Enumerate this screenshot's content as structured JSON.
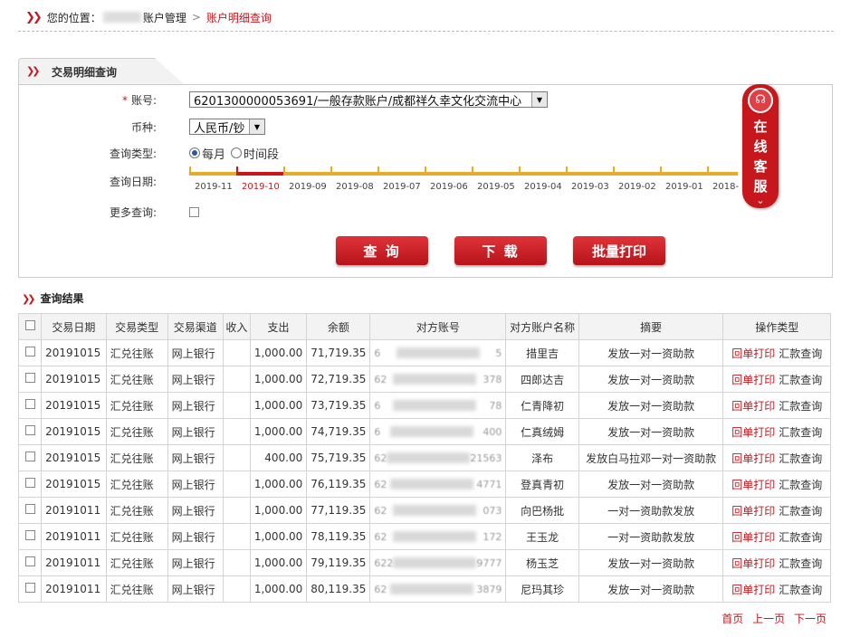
{
  "breadcrumb": {
    "prefix": "您的位置：",
    "mid": "账户管理",
    "sep": ">",
    "current": "账户明细查询"
  },
  "tab": {
    "title": "交易明细查询"
  },
  "form": {
    "account_label": "账号:",
    "account_value": "6201300000053691/一般存款账户/成都祥久幸文化交流中心",
    "currency_label": "币种:",
    "currency_value": "人民币/钞",
    "query_type_label": "查询类型:",
    "query_type_options": [
      "每月",
      "时间段"
    ],
    "query_date_label": "查询日期:",
    "months": [
      "2019-11",
      "2019-10",
      "2019-09",
      "2019-08",
      "2019-07",
      "2019-06",
      "2019-05",
      "2019-04",
      "2019-03",
      "2019-02",
      "2019-01",
      "2018-"
    ],
    "selected_month": "2019-10",
    "more_query_label": "更多查询:"
  },
  "buttons": {
    "query": "查 询",
    "download": "下 载",
    "batch_print": "批量打印"
  },
  "customer_service": {
    "text": "在线客服"
  },
  "results": {
    "title": "查询结果",
    "columns": [
      "交易日期",
      "交易类型",
      "交易渠道",
      "收入",
      "支出",
      "余额",
      "对方账号",
      "对方账户名称",
      "摘要",
      "操作类型"
    ],
    "rows": [
      {
        "date": "20191015",
        "type": "汇兑往账",
        "channel": "网上银行",
        "income": "",
        "expense": "1,000.00",
        "balance": "71,719.35",
        "acct_prefix": "6",
        "acct_suffix": "5",
        "name": "措里吉",
        "memo": "发放一对一资助款"
      },
      {
        "date": "20191015",
        "type": "汇兑往账",
        "channel": "网上银行",
        "income": "",
        "expense": "1,000.00",
        "balance": "72,719.35",
        "acct_prefix": "62",
        "acct_suffix": "378",
        "name": "四郎达吉",
        "memo": "发放一对一资助款"
      },
      {
        "date": "20191015",
        "type": "汇兑往账",
        "channel": "网上银行",
        "income": "",
        "expense": "1,000.00",
        "balance": "73,719.35",
        "acct_prefix": "6",
        "acct_suffix": "78",
        "name": "仁青降初",
        "memo": "发放一对一资助款"
      },
      {
        "date": "20191015",
        "type": "汇兑往账",
        "channel": "网上银行",
        "income": "",
        "expense": "1,000.00",
        "balance": "74,719.35",
        "acct_prefix": "6",
        "acct_suffix": "400",
        "name": "仁真绒姆",
        "memo": "发放一对一资助款"
      },
      {
        "date": "20191015",
        "type": "汇兑往账",
        "channel": "网上银行",
        "income": "",
        "expense": "400.00",
        "balance": "75,719.35",
        "acct_prefix": "62",
        "acct_suffix": "21563",
        "name": "泽布",
        "memo": "发放白马拉邓一对一资助款"
      },
      {
        "date": "20191015",
        "type": "汇兑往账",
        "channel": "网上银行",
        "income": "",
        "expense": "1,000.00",
        "balance": "76,119.35",
        "acct_prefix": "62",
        "acct_suffix": "4771",
        "name": "登真青初",
        "memo": "发放一对一资助款"
      },
      {
        "date": "20191011",
        "type": "汇兑往账",
        "channel": "网上银行",
        "income": "",
        "expense": "1,000.00",
        "balance": "77,119.35",
        "acct_prefix": "62",
        "acct_suffix": "073",
        "name": "向巴杨批",
        "memo": "一对一资助款发放"
      },
      {
        "date": "20191011",
        "type": "汇兑往账",
        "channel": "网上银行",
        "income": "",
        "expense": "1,000.00",
        "balance": "78,119.35",
        "acct_prefix": "62",
        "acct_suffix": "172",
        "name": "王玉龙",
        "memo": "一对一资助款发放"
      },
      {
        "date": "20191011",
        "type": "汇兑往账",
        "channel": "网上银行",
        "income": "",
        "expense": "1,000.00",
        "balance": "79,119.35",
        "acct_prefix": "622",
        "acct_suffix": "9777",
        "name": "杨玉芝",
        "memo": "发放一对一资助款"
      },
      {
        "date": "20191011",
        "type": "汇兑往账",
        "channel": "网上银行",
        "income": "",
        "expense": "1,000.00",
        "balance": "80,119.35",
        "acct_prefix": "62",
        "acct_suffix": "3879",
        "name": "尼玛其珍",
        "memo": "发放一对一资助款"
      }
    ],
    "action_print": "回单打印",
    "action_query": "汇款查询"
  },
  "pager": {
    "first": "首页",
    "prev": "上一页",
    "next": "下一页"
  },
  "colors": {
    "accent": "#c8161d",
    "timeline": "#e6ac2b"
  }
}
